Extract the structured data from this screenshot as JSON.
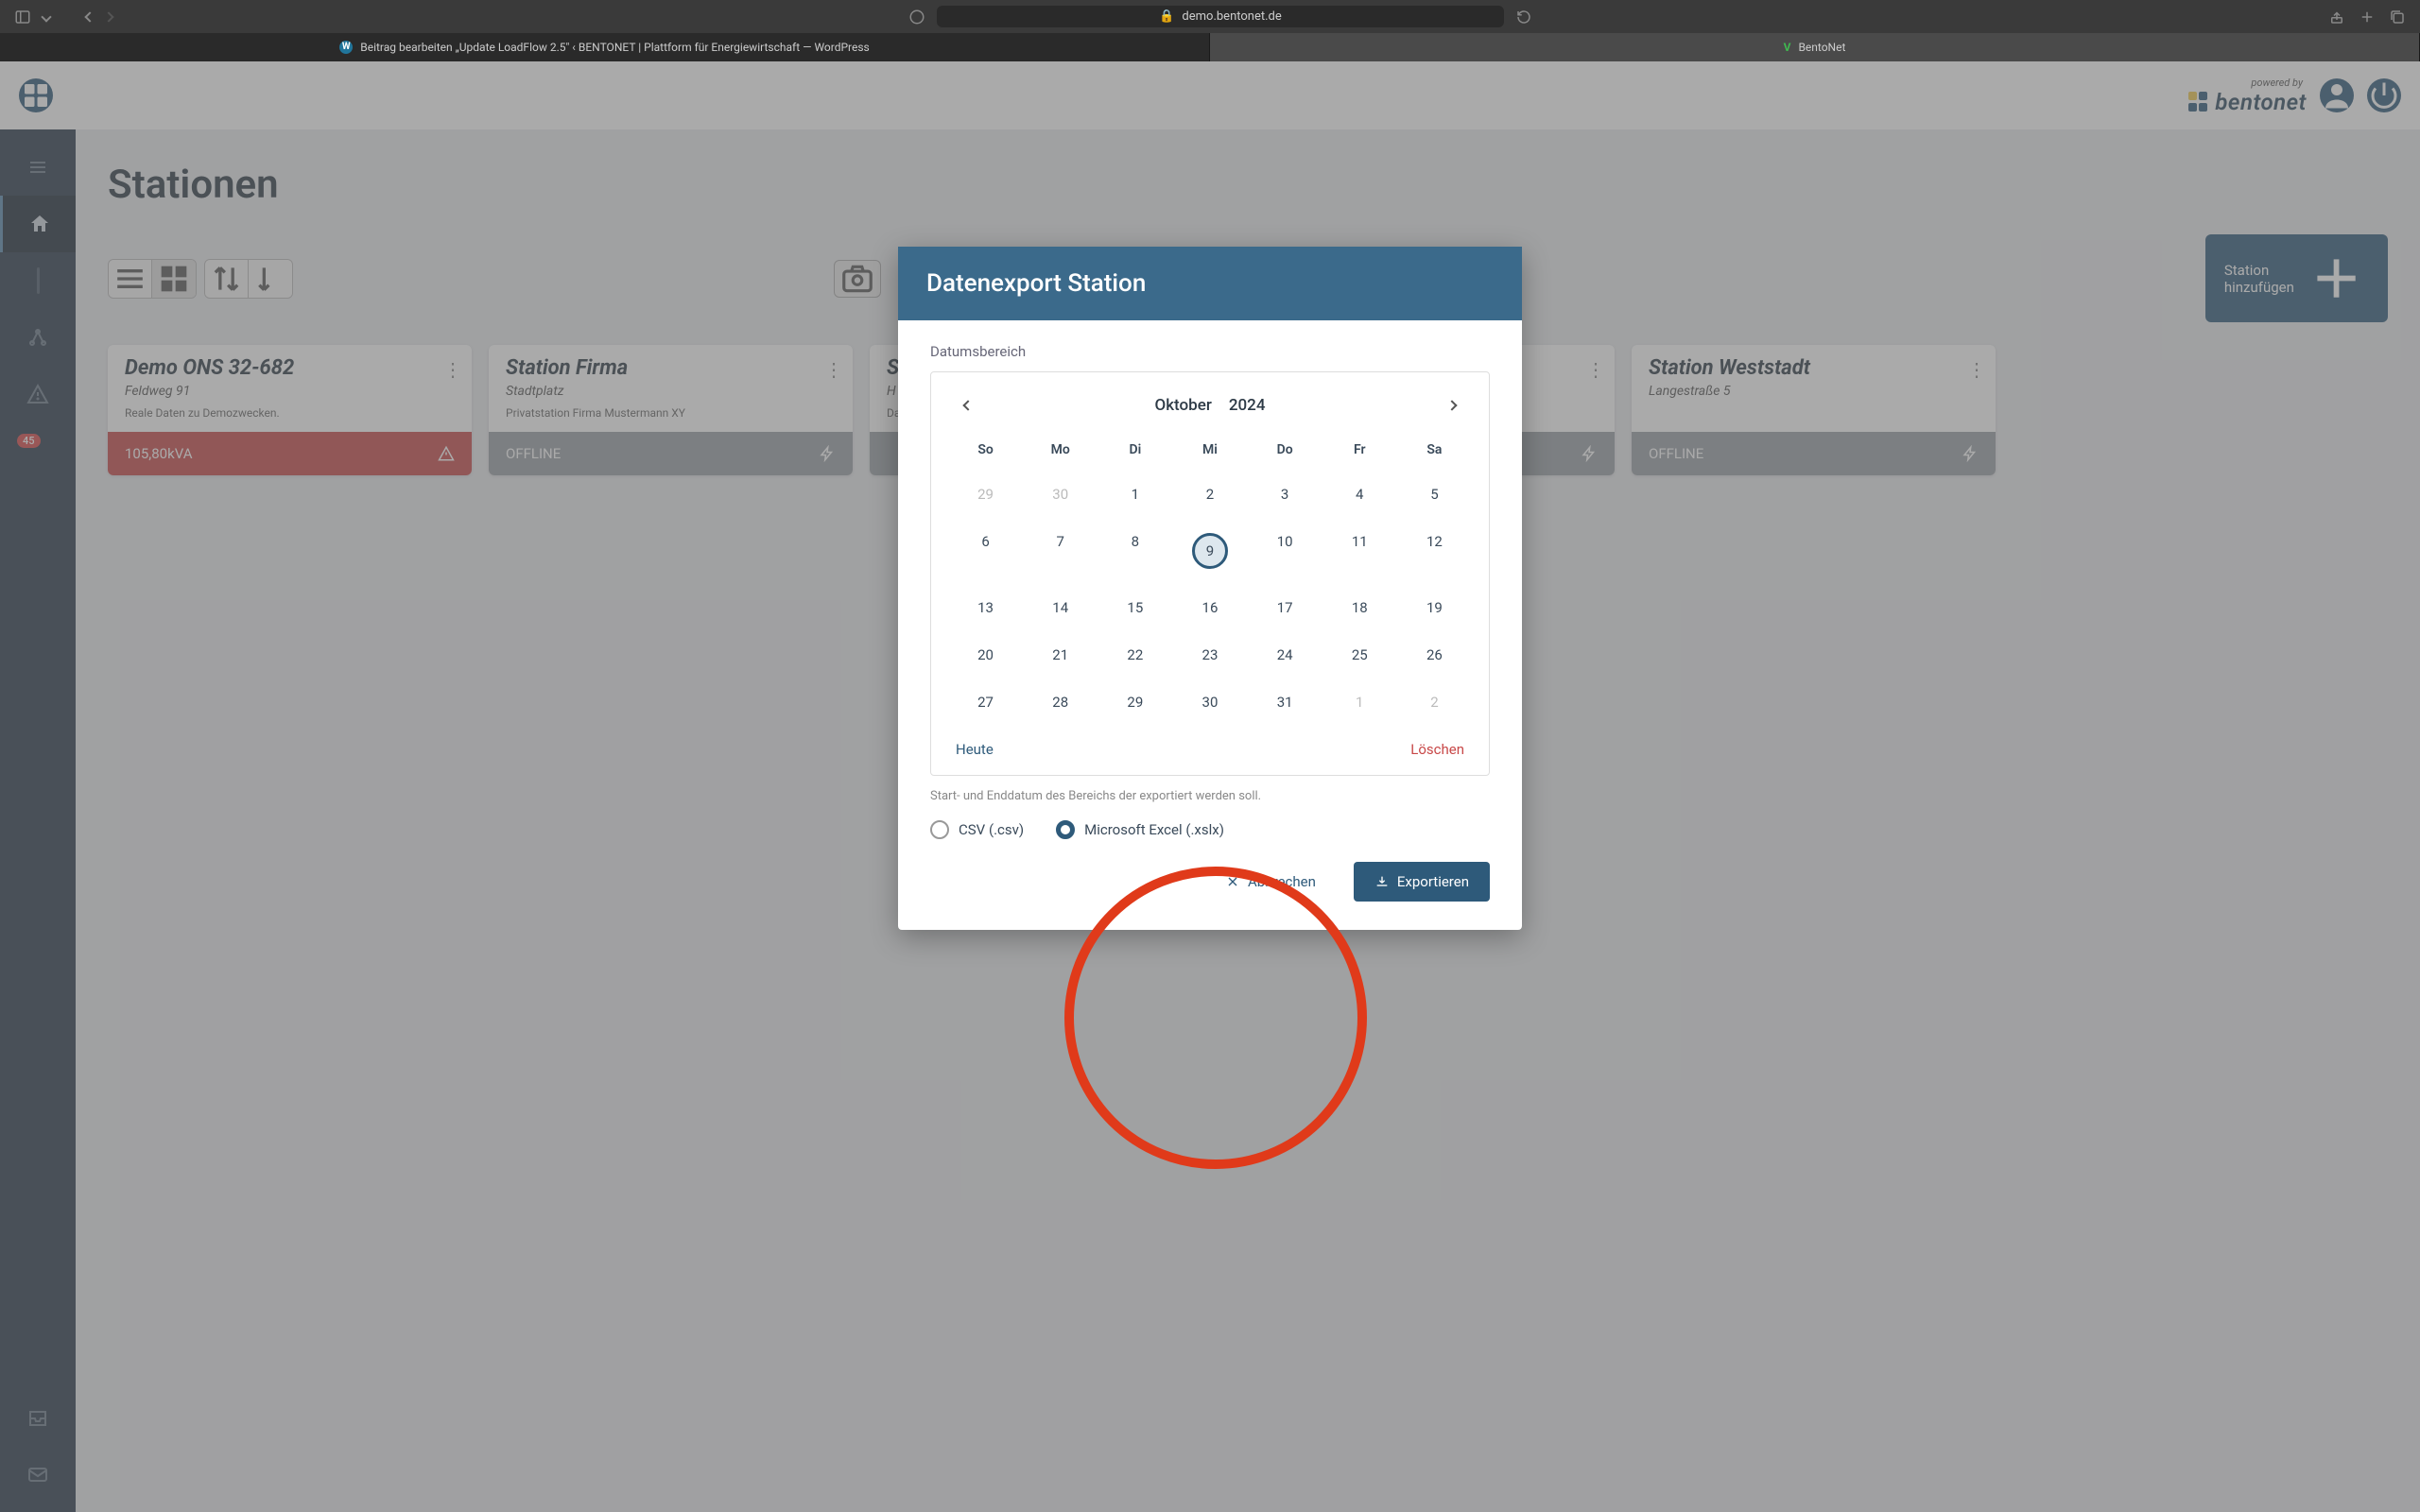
{
  "browser": {
    "url_lock": "🔒",
    "url": "demo.bentonet.de",
    "tabs": [
      {
        "label": "Beitrag bearbeiten „Update LoadFlow 2.5\" ‹ BENTONET | Plattform für Energiewirtschaft — WordPress",
        "icon": "wp"
      },
      {
        "label": "BentoNet",
        "icon": "bento"
      }
    ]
  },
  "header": {
    "powered": "powered by",
    "brand": "bentonet"
  },
  "sidebar": {
    "badge": "45"
  },
  "page": {
    "title": "Stationen",
    "add_btn": "Station hinzufügen"
  },
  "cards": [
    {
      "title": "Demo ONS 32-682",
      "sub": "Feldweg 91",
      "desc": "Reale Daten zu Demozwecken.",
      "foot": "105,80kVA",
      "foot_kind": "red"
    },
    {
      "title": "Station Firma",
      "sub": "Stadtplatz",
      "desc": "Privatstation Firma Mustermann XY",
      "foot": "OFFLINE",
      "foot_kind": "gray"
    },
    {
      "title": "S",
      "sub": "H",
      "desc": "Da",
      "foot": "",
      "foot_kind": "gray"
    },
    {
      "title": "",
      "sub": "",
      "desc": "",
      "foot": "",
      "foot_kind": "gray"
    },
    {
      "title": "Station Weststadt",
      "sub": "Langestraße 5",
      "desc": "",
      "foot": "OFFLINE",
      "foot_kind": "gray"
    }
  ],
  "modal": {
    "title": "Datenexport Station",
    "field_label": "Datumsbereich",
    "month": "Oktober",
    "year": "2024",
    "dow": [
      "So",
      "Mo",
      "Di",
      "Mi",
      "Do",
      "Fr",
      "Sa"
    ],
    "days": [
      {
        "n": "29",
        "m": true
      },
      {
        "n": "30",
        "m": true
      },
      {
        "n": "1"
      },
      {
        "n": "2"
      },
      {
        "n": "3"
      },
      {
        "n": "4"
      },
      {
        "n": "5"
      },
      {
        "n": "6"
      },
      {
        "n": "7"
      },
      {
        "n": "8"
      },
      {
        "n": "9",
        "today": true
      },
      {
        "n": "10"
      },
      {
        "n": "11"
      },
      {
        "n": "12"
      },
      {
        "n": "13"
      },
      {
        "n": "14"
      },
      {
        "n": "15"
      },
      {
        "n": "16"
      },
      {
        "n": "17"
      },
      {
        "n": "18"
      },
      {
        "n": "19"
      },
      {
        "n": "20"
      },
      {
        "n": "21"
      },
      {
        "n": "22"
      },
      {
        "n": "23"
      },
      {
        "n": "24"
      },
      {
        "n": "25"
      },
      {
        "n": "26"
      },
      {
        "n": "27"
      },
      {
        "n": "28"
      },
      {
        "n": "29"
      },
      {
        "n": "30"
      },
      {
        "n": "31"
      },
      {
        "n": "1",
        "m": true
      },
      {
        "n": "2",
        "m": true
      }
    ],
    "today_link": "Heute",
    "clear_link": "Löschen",
    "hint": "Start- und Enddatum des Bereichs der exportiert werden soll.",
    "format_csv": "CSV (.csv)",
    "format_xlsx": "Microsoft Excel (.xslx)",
    "cancel": "Abbrechen",
    "export": "Exportieren"
  }
}
